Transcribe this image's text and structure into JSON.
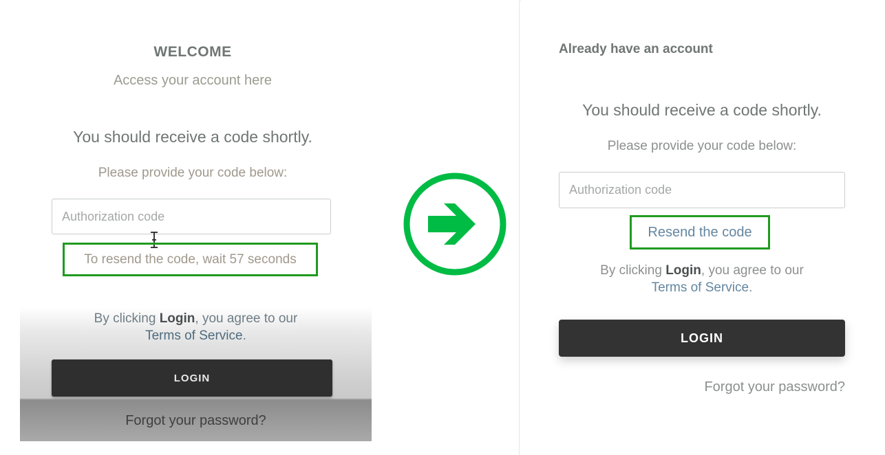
{
  "left": {
    "welcome": "WELCOME",
    "subtitle": "Access your account here",
    "code_heading": "You should receive a code shortly.",
    "code_prompt": "Please provide your code below:",
    "auth_placeholder": "Authorization code",
    "resend_wait": "To resend the code, wait 57 seconds",
    "agree_prefix": "By clicking ",
    "agree_login": "Login",
    "agree_suffix": ", you agree to our",
    "terms": "Terms of Service",
    "terms_period": ".",
    "login_label": "LOGIN",
    "forgot": "Forgot your password?"
  },
  "right": {
    "already": "Already have an account",
    "code_heading": "You should receive a code shortly.",
    "code_prompt": "Please provide your code below:",
    "auth_placeholder": "Authorization code",
    "resend": "Resend the code",
    "agree_prefix": "By clicking ",
    "agree_login": "Login",
    "agree_suffix": ", you agree to our",
    "terms": "Terms of Service",
    "terms_period": ".",
    "login_label": "LOGIN",
    "forgot": "Forgot your password?"
  },
  "colors": {
    "highlight_border": "#1f9a1f",
    "arrow_green": "#00bb44",
    "button_dark": "#333333",
    "link_blue": "#6486a0"
  },
  "icons": {
    "arrow": "arrow-right-circle-icon",
    "cursor": "text-cursor-icon"
  }
}
